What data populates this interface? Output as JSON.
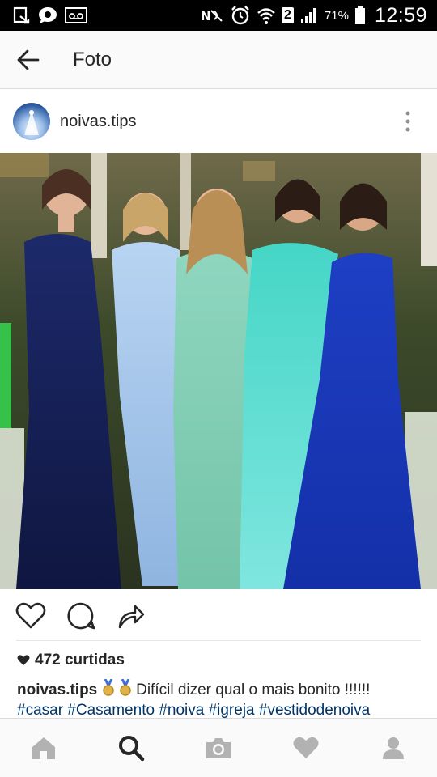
{
  "status_bar": {
    "battery_pct": "71%",
    "time": "12:59",
    "sim_slot": "2"
  },
  "app_bar": {
    "title": "Foto"
  },
  "post": {
    "username": "noivas.tips",
    "likes_label": "472 curtidas",
    "caption_user": "noivas.tips",
    "caption_text": "Difícil dizer qual o mais bonito !!!!!!",
    "hashtags": "#casar #Casamento #noiva #igreja #vestidodenoiva"
  },
  "colors": {
    "hashtag": "#003569",
    "text": "#262626",
    "icon_gray": "#b2b2b2",
    "nav_active": "#262626"
  },
  "bottom_nav": {
    "items": [
      "home-icon",
      "search-icon",
      "camera-icon",
      "heart-icon",
      "profile-icon"
    ],
    "active": "search-icon"
  }
}
